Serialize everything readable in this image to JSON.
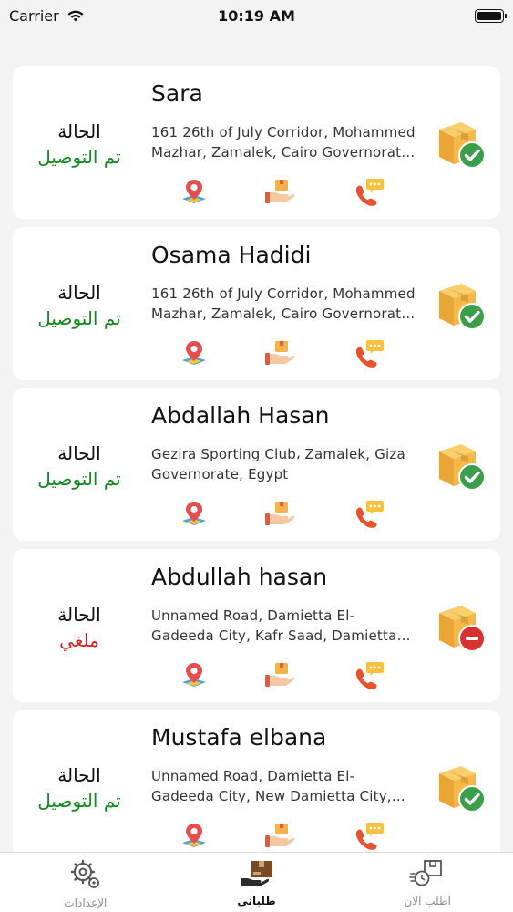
{
  "status_bar": {
    "carrier": "Carrier",
    "time": "10:19 AM"
  },
  "colors": {
    "delivered": "#12891f",
    "cancelled": "#d62020",
    "check_badge": "#3a9e4a",
    "cancel_badge": "#d9312f",
    "box": "#f2b544"
  },
  "orders": [
    {
      "name": "Sara",
      "address": "161 26th of July Corridor, Mohammed Mazhar, Zamalek, Cairo Governorate, Egypt",
      "status_label": "الحالة",
      "status_value": "تم التوصيل",
      "state": "delivered",
      "package_icon": "box-check-icon"
    },
    {
      "name": "Osama Hadidi",
      "address": "161 26th of July Corridor, Mohammed Mazhar, Zamalek, Cairo Governorate, Egypt",
      "status_label": "الحالة",
      "status_value": "تم التوصيل",
      "state": "delivered",
      "package_icon": "box-check-icon"
    },
    {
      "name": "Abdallah Hasan",
      "address": "Gezira Sporting Club، Zamalek, Giza Governorate, Egypt",
      "status_label": "الحالة",
      "status_value": "تم التوصيل",
      "state": "delivered",
      "package_icon": "box-check-icon"
    },
    {
      "name": "Abdullah hasan",
      "address": "Unnamed Road, Damietta El-Gadeeda City, Kafr Saad, Damietta Governorate, Egypt",
      "status_label": "الحالة",
      "status_value": "ملغي",
      "state": "cancelled",
      "package_icon": "box-cancel-icon"
    },
    {
      "name": "Mustafa elbana",
      "address": "Unnamed Road, Damietta El-Gadeeda City, New Damietta City, Damietta Governorate, Egypt",
      "status_label": "الحالة",
      "status_value": "تم التوصيل",
      "state": "delivered",
      "package_icon": "box-check-icon"
    }
  ],
  "tab_bar": {
    "tabs": [
      {
        "label": "الإعدادات",
        "icon": "gear-icon",
        "active": false
      },
      {
        "label": "طلباتي",
        "icon": "my-orders-icon",
        "active": true
      },
      {
        "label": "اطلب الآن",
        "icon": "order-now-icon",
        "active": false
      }
    ]
  }
}
